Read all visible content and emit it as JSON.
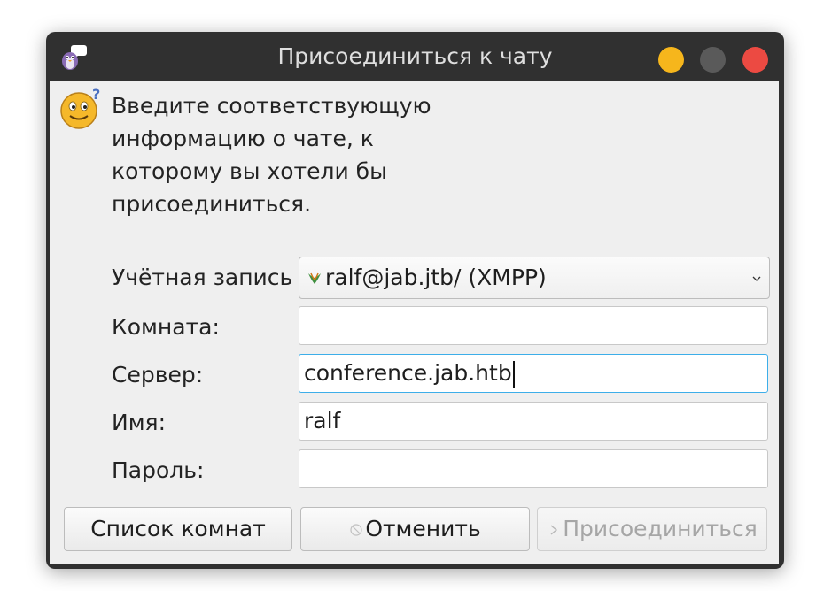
{
  "window": {
    "title": "Присоединиться к чату"
  },
  "intro": {
    "line1": "Введите соответствующую",
    "line2": "информацию о чате, к",
    "line3": "которому вы хотели бы",
    "line4": "присоединиться."
  },
  "form": {
    "account_label": "Учётная запись",
    "account_value": "ralf@jab.jtb/ (XMPP)",
    "room_label": "Комната:",
    "room_value": "",
    "server_label": "Сервер:",
    "server_value": "conference.jab.htb",
    "name_label": "Имя:",
    "name_value": "ralf",
    "password_label": "Пароль:",
    "password_value": ""
  },
  "buttons": {
    "room_list": "Список комнат",
    "cancel": "Отменить",
    "join": "Присоединиться"
  },
  "colors": {
    "titlebar": "#303030",
    "minimize": "#f6b61c",
    "maximize": "#5a5a5a",
    "close": "#ec4a42",
    "focus_border": "#3daee9"
  },
  "icons": {
    "app": "pidgin-icon",
    "dialog": "question-smiley-icon",
    "account": "xmpp-icon",
    "cancel": "cancel-icon",
    "join": "join-arrow-icon"
  }
}
